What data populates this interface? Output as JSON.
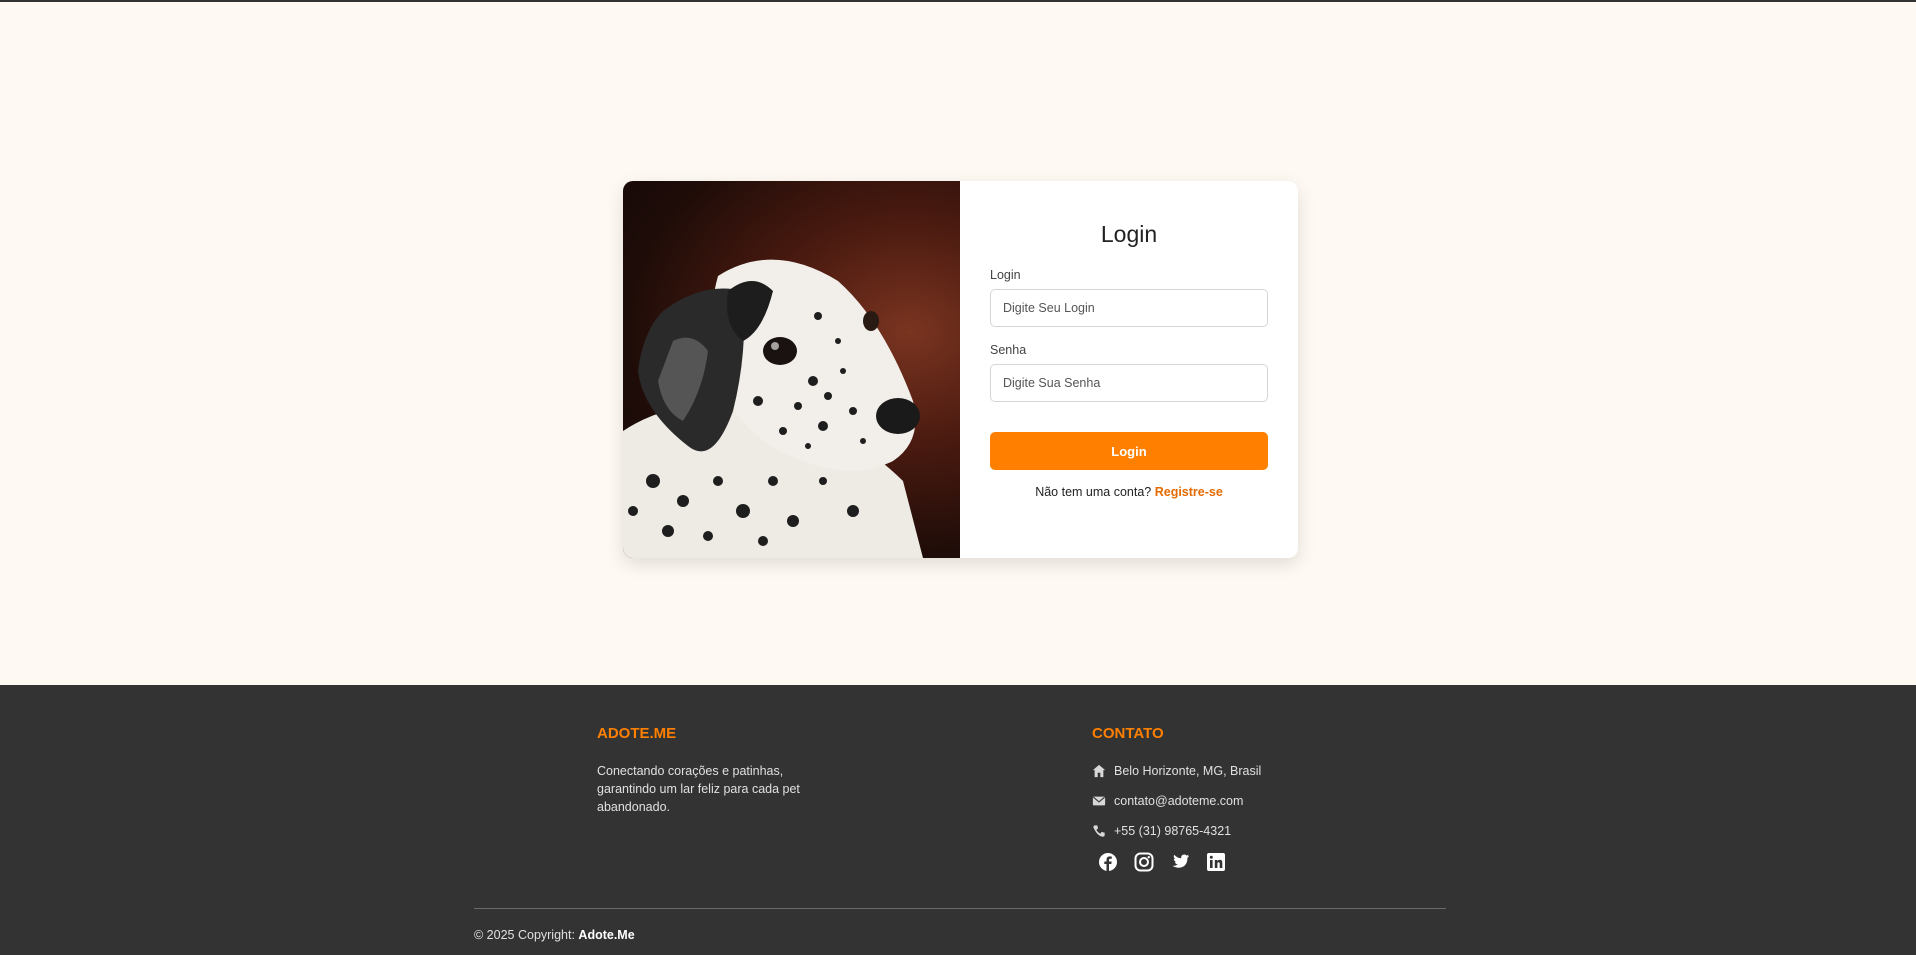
{
  "login_card": {
    "title": "Login",
    "login_label": "Login",
    "login_placeholder": "Digite Seu Login",
    "password_label": "Senha",
    "password_placeholder": "Digite Sua Senha",
    "submit_label": "Login",
    "no_account_text": "Não tem uma conta?",
    "register_link": "Registre-se"
  },
  "footer": {
    "brand_title": "ADOTE.ME",
    "brand_description": "Conectando corações e patinhas, garantindo um lar feliz para cada pet abandonado.",
    "contact_title": "CONTATO",
    "contacts": [
      {
        "icon": "home-icon",
        "text": "Belo Horizonte, MG, Brasil"
      },
      {
        "icon": "envelope-icon",
        "text": "contato@adoteme.com"
      },
      {
        "icon": "phone-icon",
        "text": "+55 (31) 98765-4321"
      }
    ],
    "social": [
      "facebook-icon",
      "instagram-icon",
      "twitter-icon",
      "linkedin-icon"
    ],
    "copyright_prefix": "© 2025 Copyright:",
    "copyright_brand": "Adote.Me"
  },
  "colors": {
    "accent": "#ff8000",
    "page_bg": "#fff9f3",
    "footer_bg": "#333333"
  }
}
